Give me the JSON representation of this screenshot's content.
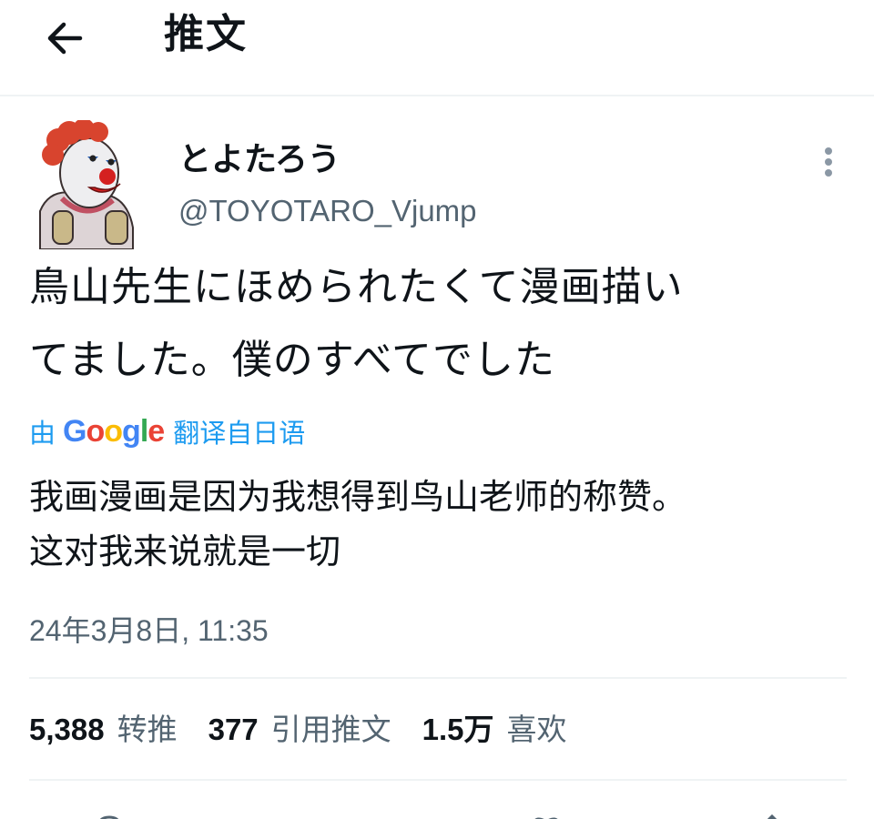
{
  "header": {
    "title": "推文",
    "back_icon": "arrow-left-icon"
  },
  "author": {
    "display_name": "とよたろう",
    "handle": "@TOYOTARO_Vjump",
    "avatar": "clown-avatar"
  },
  "tweet": {
    "text_lines": [
      "鳥山先生にほめられたくて漫画描い",
      "てました。僕のすべてでした"
    ],
    "translate": {
      "prefix": "由",
      "provider": "Google",
      "suffix": "翻译自日语"
    },
    "translation_lines": [
      "我画漫画是因为我想得到鸟山老师的称赞。",
      "这对我来说就是一切"
    ],
    "timestamp": "24年3月8日, 11:35"
  },
  "stats": [
    {
      "count": "5,388",
      "label": "转推"
    },
    {
      "count": "377",
      "label": "引用推文"
    },
    {
      "count": "1.5万",
      "label": "喜欢"
    }
  ],
  "colors": {
    "accent": "#1d9bf0",
    "secondary_text": "#536471",
    "divider": "#eff3f4"
  },
  "actions": [
    "reply-icon",
    "retweet-icon",
    "like-icon",
    "share-icon"
  ]
}
